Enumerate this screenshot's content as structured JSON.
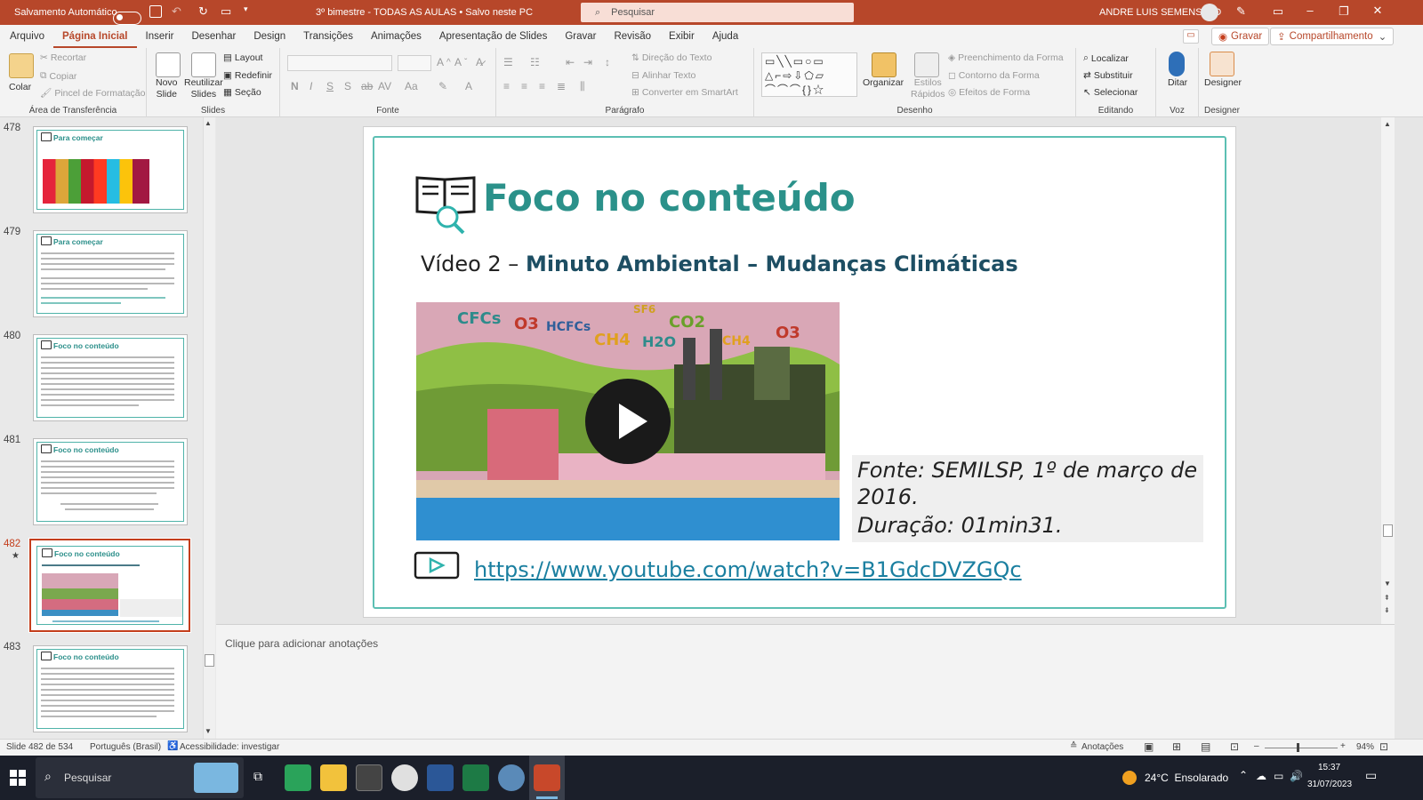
{
  "titlebar": {
    "autosave_label": "Salvamento Automático",
    "document_title": "3º bimestre - TODAS AS AULAS • Salvo neste PC",
    "search_placeholder": "Pesquisar",
    "user_name": "ANDRE LUIS SEMENSATO"
  },
  "menu": {
    "tabs": [
      "Arquivo",
      "Página Inicial",
      "Inserir",
      "Desenhar",
      "Design",
      "Transições",
      "Animações",
      "Apresentação de Slides",
      "Gravar",
      "Revisão",
      "Exibir",
      "Ajuda"
    ],
    "record_label": "Gravar",
    "share_label": "Compartilhamento"
  },
  "ribbon": {
    "clipboard": {
      "paste": "Colar",
      "cut": "Recortar",
      "copy": "Copiar",
      "format_painter": "Pincel de Formatação",
      "group": "Área de Transferência"
    },
    "slides": {
      "new_slide": "Novo\nSlide",
      "reuse": "Reutilizar\nSlides",
      "layout": "Layout",
      "reset": "Redefinir",
      "section": "Seção",
      "group": "Slides"
    },
    "font": {
      "group": "Fonte"
    },
    "paragraph": {
      "text_direction": "Direção do Texto",
      "align_text": "Alinhar Texto",
      "smartart": "Converter em SmartArt",
      "group": "Parágrafo"
    },
    "drawing": {
      "arrange": "Organizar",
      "quick_styles": "Estilos\nRápidos",
      "fill": "Preenchimento da Forma",
      "outline": "Contorno da Forma",
      "effects": "Efeitos de Forma",
      "group": "Desenho"
    },
    "editing": {
      "find": "Localizar",
      "replace": "Substituir",
      "select": "Selecionar",
      "group": "Editando"
    },
    "voice": {
      "dictate": "Ditar",
      "group": "Voz"
    },
    "designer": {
      "label": "Designer",
      "group": "Designer"
    }
  },
  "thumbnails": [
    {
      "num": "478",
      "title": "Para começar"
    },
    {
      "num": "479",
      "title": "Para começar"
    },
    {
      "num": "480",
      "title": "Foco no conteúdo"
    },
    {
      "num": "481",
      "title": "Foco no conteúdo"
    },
    {
      "num": "482",
      "title": "Foco no conteúdo",
      "selected": true
    },
    {
      "num": "483",
      "title": "Foco no conteúdo"
    }
  ],
  "slide": {
    "title": "Foco no conteúdo",
    "subtitle_prefix": "Vídeo 2 – ",
    "subtitle_bold": "Minuto Ambiental – Mudanças Climáticas",
    "source_line1": "Fonte: SEMILSP, 1º de março de 2016.",
    "source_line2": "Duração: 01min31.",
    "link": "https://www.youtube.com/watch?v=B1GdcDVZGQc",
    "video_labels": [
      "CFCs",
      "O3",
      "HCFCs",
      "CH4",
      "H2O",
      "SF6",
      "CO2",
      "CH4",
      "O3"
    ]
  },
  "notes_placeholder": "Clique para adicionar anotações",
  "status": {
    "slide_count": "Slide 482 de 534",
    "language": "Português (Brasil)",
    "accessibility": "Acessibilidade: investigar",
    "notes": "Anotações",
    "zoom": "94%"
  },
  "taskbar": {
    "search": "Pesquisar",
    "weather": "24°C  Ensolarado",
    "time": "15:37",
    "date": "31/07/2023"
  },
  "colors": {
    "accent": "#b7472a",
    "teal": "#2b918a",
    "link": "#1a7fa0"
  }
}
